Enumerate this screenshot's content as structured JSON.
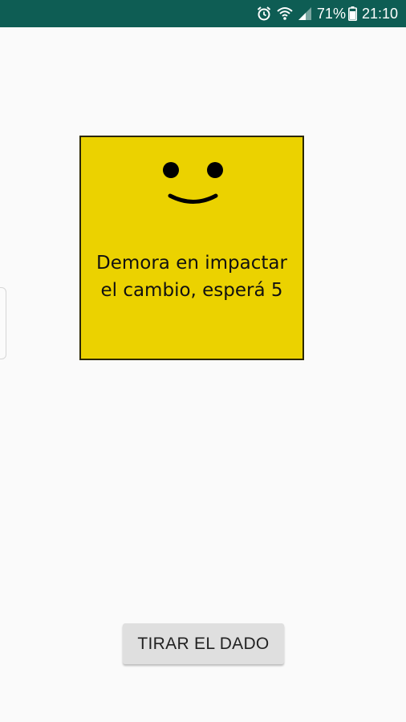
{
  "status_bar": {
    "battery_percent": "71%",
    "time": "21:10",
    "icons": [
      "alarm-icon",
      "wifi-icon",
      "signal-icon",
      "battery-icon"
    ],
    "background_color": "#0e5d54"
  },
  "dice": {
    "face_icon": "smiley-face-icon",
    "message_line1": "Demora en impactar",
    "message_line2": "el cambio, esperá 5",
    "background_color": "#ebd200"
  },
  "actions": {
    "roll_button_label": "TIRAR EL DADO"
  }
}
